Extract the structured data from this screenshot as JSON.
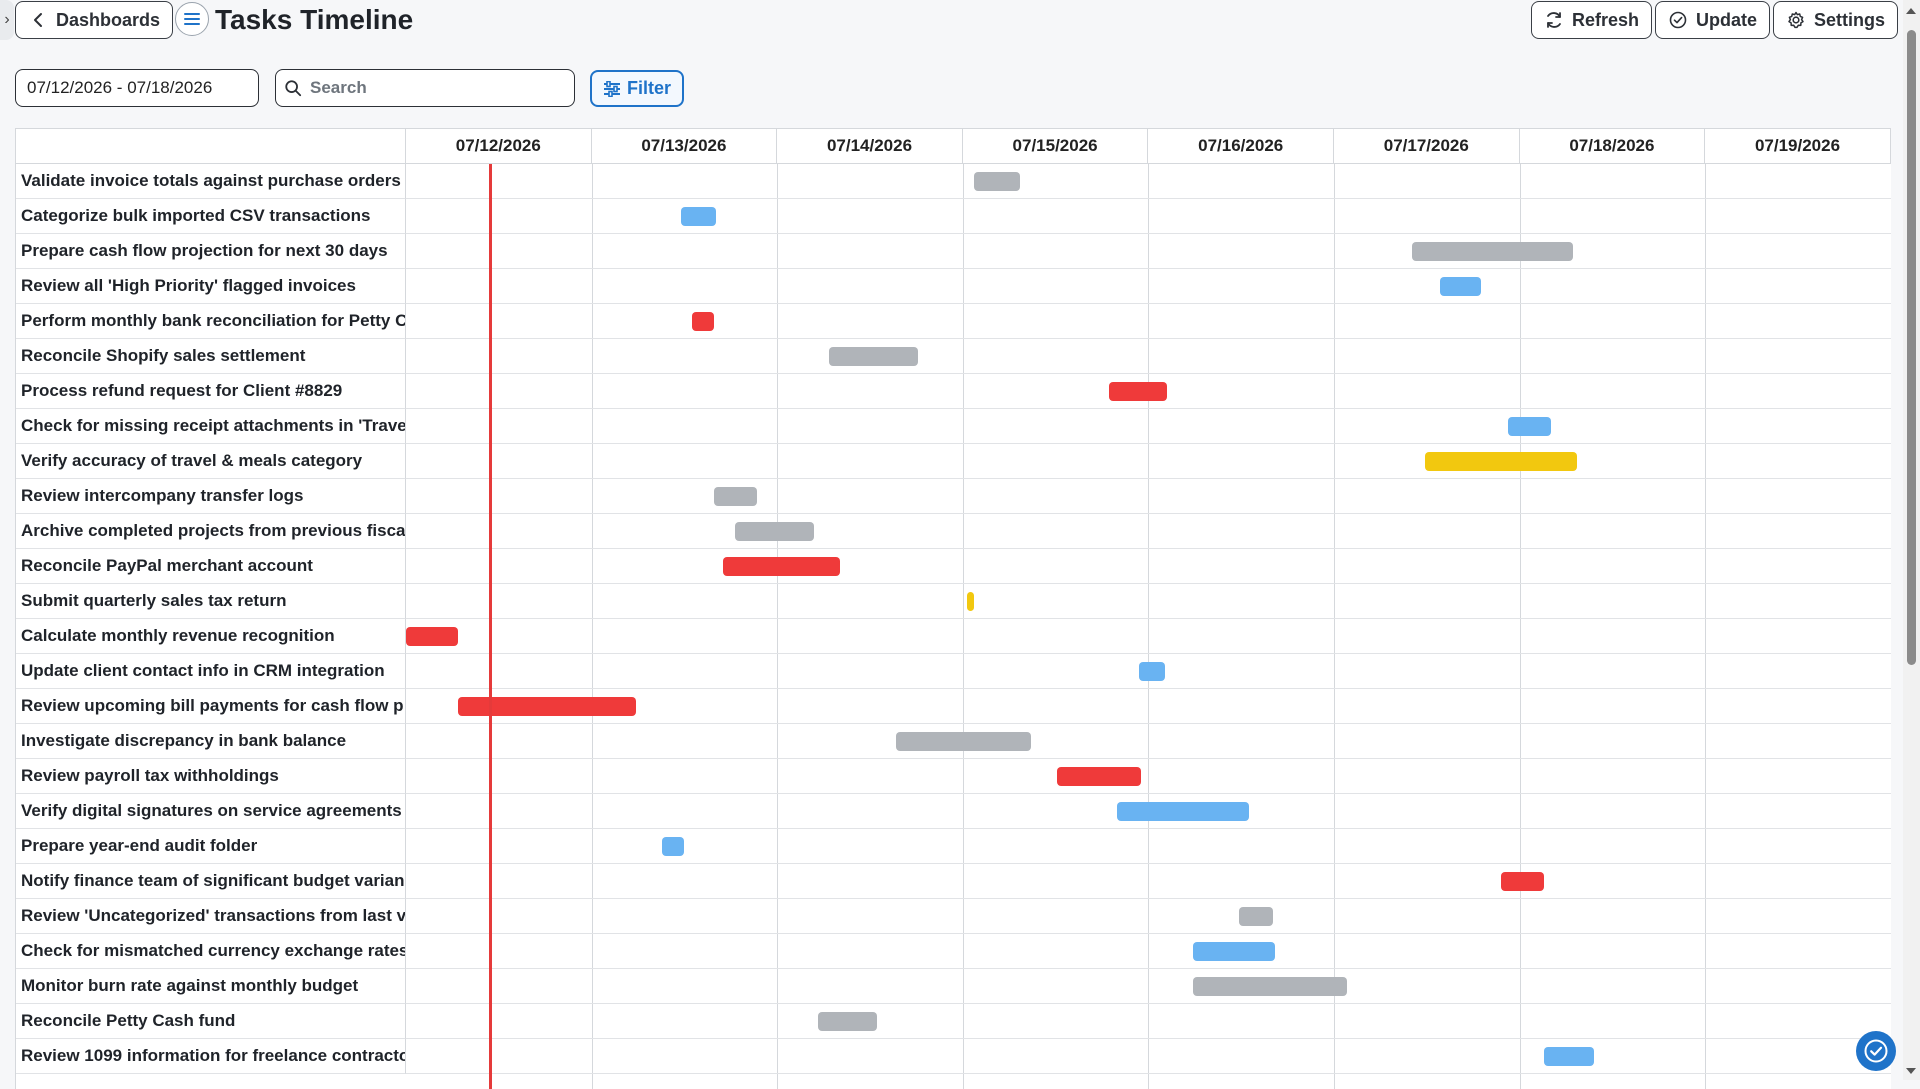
{
  "header": {
    "back_label": "Dashboards",
    "title": "Tasks Timeline",
    "refresh_label": "Refresh",
    "update_label": "Update",
    "settings_label": "Settings"
  },
  "toolbar": {
    "date_range": "07/12/2026 - 07/18/2026",
    "search_placeholder": "Search",
    "filter_label": "Filter"
  },
  "colors": {
    "red": "#ef3a3a",
    "gray": "#b0b4b9",
    "blue": "#69b3f2",
    "yellow": "#f2c80f",
    "accent": "#1f73c9"
  },
  "timeline": {
    "dates": [
      "07/12/2026",
      "07/13/2026",
      "07/14/2026",
      "07/15/2026",
      "07/16/2026",
      "07/17/2026",
      "07/18/2026",
      "07/19/2026"
    ],
    "today_marker": "07/12/2026",
    "tasks": [
      {
        "name": "Validate invoice totals against purchase orders",
        "color": "gray",
        "start_day": 3.06,
        "end_day": 3.31
      },
      {
        "name": "Categorize bulk imported CSV transactions",
        "color": "blue",
        "start_day": 1.48,
        "end_day": 1.67
      },
      {
        "name": "Prepare cash flow projection for next 30 days",
        "color": "gray",
        "start_day": 5.42,
        "end_day": 6.29
      },
      {
        "name": "Review all 'High Priority' flagged invoices",
        "color": "blue",
        "start_day": 5.57,
        "end_day": 5.79
      },
      {
        "name": "Perform monthly bank reconciliation for Petty C",
        "color": "red",
        "start_day": 1.54,
        "end_day": 1.66
      },
      {
        "name": "Reconcile Shopify sales settlement",
        "color": "gray",
        "start_day": 2.28,
        "end_day": 2.76
      },
      {
        "name": "Process refund request for Client #8829",
        "color": "red",
        "start_day": 3.79,
        "end_day": 4.1
      },
      {
        "name": "Check for missing receipt attachments in 'Trave",
        "color": "blue",
        "start_day": 5.94,
        "end_day": 6.17
      },
      {
        "name": "Verify accuracy of travel & meals category",
        "color": "yellow",
        "start_day": 5.49,
        "end_day": 6.31
      },
      {
        "name": "Review intercompany transfer logs",
        "color": "gray",
        "start_day": 1.66,
        "end_day": 1.89
      },
      {
        "name": "Archive completed projects from previous fisca",
        "color": "gray",
        "start_day": 1.77,
        "end_day": 2.2
      },
      {
        "name": "Reconcile PayPal merchant account",
        "color": "red",
        "start_day": 1.71,
        "end_day": 2.34
      },
      {
        "name": "Submit quarterly sales tax return",
        "color": "yellow",
        "start_day": 3.02,
        "end_day": 3.06
      },
      {
        "name": "Calculate monthly revenue recognition",
        "color": "red",
        "start_day": 0.0,
        "end_day": 0.28
      },
      {
        "name": "Update client contact info in CRM integration",
        "color": "blue",
        "start_day": 3.95,
        "end_day": 4.09
      },
      {
        "name": "Review upcoming bill payments for cash flow p",
        "color": "red",
        "start_day": 0.28,
        "end_day": 1.24
      },
      {
        "name": "Investigate discrepancy in bank balance",
        "color": "gray",
        "start_day": 2.64,
        "end_day": 3.37
      },
      {
        "name": "Review payroll tax withholdings",
        "color": "red",
        "start_day": 3.51,
        "end_day": 3.96
      },
      {
        "name": "Verify digital signatures on service agreements",
        "color": "blue",
        "start_day": 3.83,
        "end_day": 4.54
      },
      {
        "name": "Prepare year-end audit folder",
        "color": "blue",
        "start_day": 1.38,
        "end_day": 1.5
      },
      {
        "name": "Notify finance team of significant budget varian",
        "color": "red",
        "start_day": 5.9,
        "end_day": 6.13
      },
      {
        "name": "Review 'Uncategorized' transactions from last v",
        "color": "gray",
        "start_day": 4.49,
        "end_day": 4.67
      },
      {
        "name": "Check for mismatched currency exchange rates",
        "color": "blue",
        "start_day": 4.24,
        "end_day": 4.68
      },
      {
        "name": "Monitor burn rate against monthly budget",
        "color": "gray",
        "start_day": 4.24,
        "end_day": 5.07
      },
      {
        "name": "Reconcile Petty Cash fund",
        "color": "gray",
        "start_day": 2.22,
        "end_day": 2.54
      },
      {
        "name": "Review 1099 information for freelance contracto",
        "color": "blue",
        "start_day": 6.13,
        "end_day": 6.4
      }
    ]
  }
}
